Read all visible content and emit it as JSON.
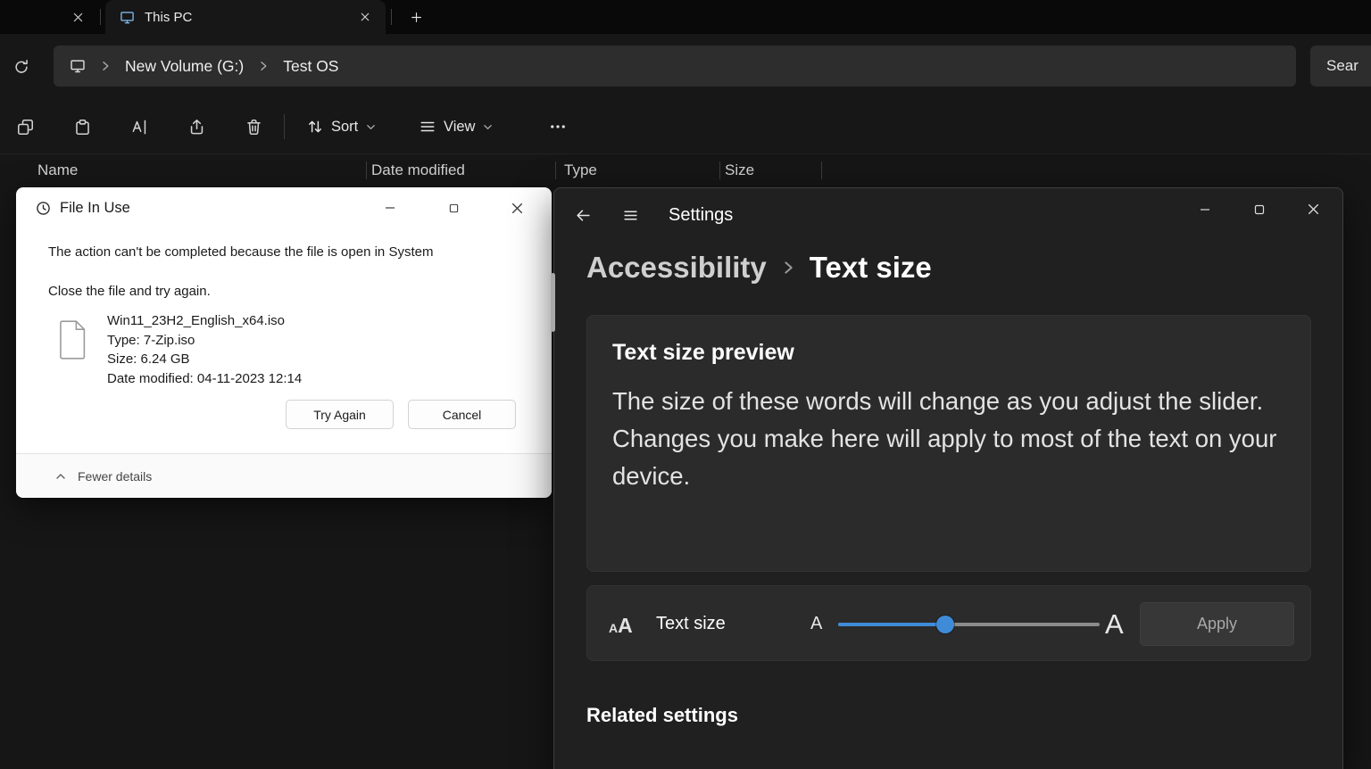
{
  "explorer": {
    "tab": {
      "title": "This PC"
    },
    "address": {
      "crumb1": "New Volume (G:)",
      "crumb2": "Test OS"
    },
    "search": {
      "value": "Sear"
    },
    "toolbar": {
      "sort_label": "Sort",
      "view_label": "View"
    },
    "columns": [
      "Name",
      "Date modified",
      "Type",
      "Size"
    ]
  },
  "dialog": {
    "title": "File In Use",
    "message_line1": "The action can't be completed because the file is open in System",
    "message_line2": "Close the file and try again.",
    "file": {
      "name": "Win11_23H2_English_x64.iso",
      "type_line": "Type: 7-Zip.iso",
      "size_line": "Size: 6.24 GB",
      "modified_line": "Date modified: 04-11-2023 12:14"
    },
    "try_again_label": "Try Again",
    "cancel_label": "Cancel",
    "fewer_details_label": "Fewer details"
  },
  "settings": {
    "title": "Settings",
    "breadcrumb": {
      "parent": "Accessibility",
      "current": "Text size"
    },
    "preview": {
      "heading": "Text size preview",
      "body": "The size of these words will change as you adjust the slider. Changes you make here will apply to most of the text on your device."
    },
    "text_size_row": {
      "label": "Text size",
      "a_small": "A",
      "a_large": "A",
      "apply_label": "Apply",
      "slider_value_percent": 41
    },
    "related_heading": "Related settings"
  },
  "colors": {
    "accent": "#3f8bd8",
    "explorer_bg": "#161616",
    "settings_bg": "#202020",
    "card_bg": "#2b2b2b",
    "dialog_bg": "#ffffff"
  }
}
